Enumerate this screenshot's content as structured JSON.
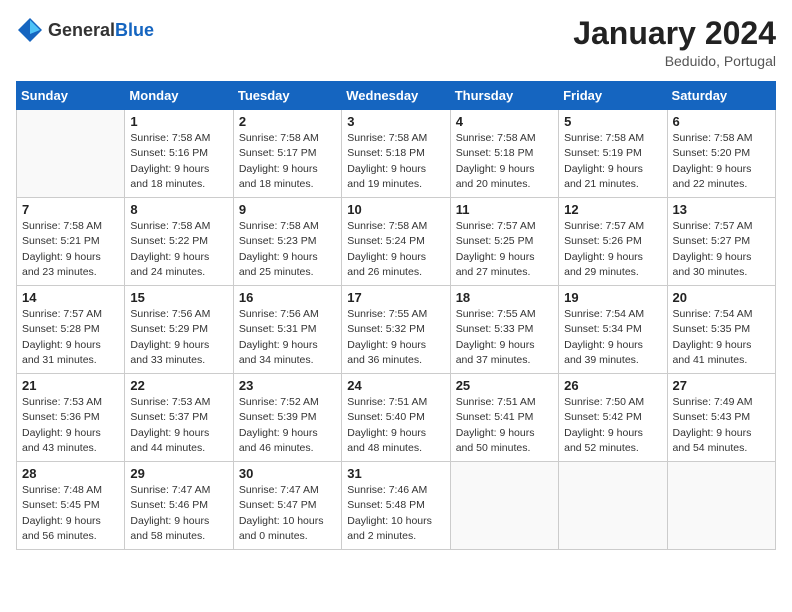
{
  "logo": {
    "general": "General",
    "blue": "Blue"
  },
  "title": "January 2024",
  "location": "Beduido, Portugal",
  "days_header": [
    "Sunday",
    "Monday",
    "Tuesday",
    "Wednesday",
    "Thursday",
    "Friday",
    "Saturday"
  ],
  "weeks": [
    [
      {
        "day": "",
        "info": ""
      },
      {
        "day": "1",
        "info": "Sunrise: 7:58 AM\nSunset: 5:16 PM\nDaylight: 9 hours\nand 18 minutes."
      },
      {
        "day": "2",
        "info": "Sunrise: 7:58 AM\nSunset: 5:17 PM\nDaylight: 9 hours\nand 18 minutes."
      },
      {
        "day": "3",
        "info": "Sunrise: 7:58 AM\nSunset: 5:18 PM\nDaylight: 9 hours\nand 19 minutes."
      },
      {
        "day": "4",
        "info": "Sunrise: 7:58 AM\nSunset: 5:18 PM\nDaylight: 9 hours\nand 20 minutes."
      },
      {
        "day": "5",
        "info": "Sunrise: 7:58 AM\nSunset: 5:19 PM\nDaylight: 9 hours\nand 21 minutes."
      },
      {
        "day": "6",
        "info": "Sunrise: 7:58 AM\nSunset: 5:20 PM\nDaylight: 9 hours\nand 22 minutes."
      }
    ],
    [
      {
        "day": "7",
        "info": "Sunrise: 7:58 AM\nSunset: 5:21 PM\nDaylight: 9 hours\nand 23 minutes."
      },
      {
        "day": "8",
        "info": "Sunrise: 7:58 AM\nSunset: 5:22 PM\nDaylight: 9 hours\nand 24 minutes."
      },
      {
        "day": "9",
        "info": "Sunrise: 7:58 AM\nSunset: 5:23 PM\nDaylight: 9 hours\nand 25 minutes."
      },
      {
        "day": "10",
        "info": "Sunrise: 7:58 AM\nSunset: 5:24 PM\nDaylight: 9 hours\nand 26 minutes."
      },
      {
        "day": "11",
        "info": "Sunrise: 7:57 AM\nSunset: 5:25 PM\nDaylight: 9 hours\nand 27 minutes."
      },
      {
        "day": "12",
        "info": "Sunrise: 7:57 AM\nSunset: 5:26 PM\nDaylight: 9 hours\nand 29 minutes."
      },
      {
        "day": "13",
        "info": "Sunrise: 7:57 AM\nSunset: 5:27 PM\nDaylight: 9 hours\nand 30 minutes."
      }
    ],
    [
      {
        "day": "14",
        "info": "Sunrise: 7:57 AM\nSunset: 5:28 PM\nDaylight: 9 hours\nand 31 minutes."
      },
      {
        "day": "15",
        "info": "Sunrise: 7:56 AM\nSunset: 5:29 PM\nDaylight: 9 hours\nand 33 minutes."
      },
      {
        "day": "16",
        "info": "Sunrise: 7:56 AM\nSunset: 5:31 PM\nDaylight: 9 hours\nand 34 minutes."
      },
      {
        "day": "17",
        "info": "Sunrise: 7:55 AM\nSunset: 5:32 PM\nDaylight: 9 hours\nand 36 minutes."
      },
      {
        "day": "18",
        "info": "Sunrise: 7:55 AM\nSunset: 5:33 PM\nDaylight: 9 hours\nand 37 minutes."
      },
      {
        "day": "19",
        "info": "Sunrise: 7:54 AM\nSunset: 5:34 PM\nDaylight: 9 hours\nand 39 minutes."
      },
      {
        "day": "20",
        "info": "Sunrise: 7:54 AM\nSunset: 5:35 PM\nDaylight: 9 hours\nand 41 minutes."
      }
    ],
    [
      {
        "day": "21",
        "info": "Sunrise: 7:53 AM\nSunset: 5:36 PM\nDaylight: 9 hours\nand 43 minutes."
      },
      {
        "day": "22",
        "info": "Sunrise: 7:53 AM\nSunset: 5:37 PM\nDaylight: 9 hours\nand 44 minutes."
      },
      {
        "day": "23",
        "info": "Sunrise: 7:52 AM\nSunset: 5:39 PM\nDaylight: 9 hours\nand 46 minutes."
      },
      {
        "day": "24",
        "info": "Sunrise: 7:51 AM\nSunset: 5:40 PM\nDaylight: 9 hours\nand 48 minutes."
      },
      {
        "day": "25",
        "info": "Sunrise: 7:51 AM\nSunset: 5:41 PM\nDaylight: 9 hours\nand 50 minutes."
      },
      {
        "day": "26",
        "info": "Sunrise: 7:50 AM\nSunset: 5:42 PM\nDaylight: 9 hours\nand 52 minutes."
      },
      {
        "day": "27",
        "info": "Sunrise: 7:49 AM\nSunset: 5:43 PM\nDaylight: 9 hours\nand 54 minutes."
      }
    ],
    [
      {
        "day": "28",
        "info": "Sunrise: 7:48 AM\nSunset: 5:45 PM\nDaylight: 9 hours\nand 56 minutes."
      },
      {
        "day": "29",
        "info": "Sunrise: 7:47 AM\nSunset: 5:46 PM\nDaylight: 9 hours\nand 58 minutes."
      },
      {
        "day": "30",
        "info": "Sunrise: 7:47 AM\nSunset: 5:47 PM\nDaylight: 10 hours\nand 0 minutes."
      },
      {
        "day": "31",
        "info": "Sunrise: 7:46 AM\nSunset: 5:48 PM\nDaylight: 10 hours\nand 2 minutes."
      },
      {
        "day": "",
        "info": ""
      },
      {
        "day": "",
        "info": ""
      },
      {
        "day": "",
        "info": ""
      }
    ]
  ]
}
